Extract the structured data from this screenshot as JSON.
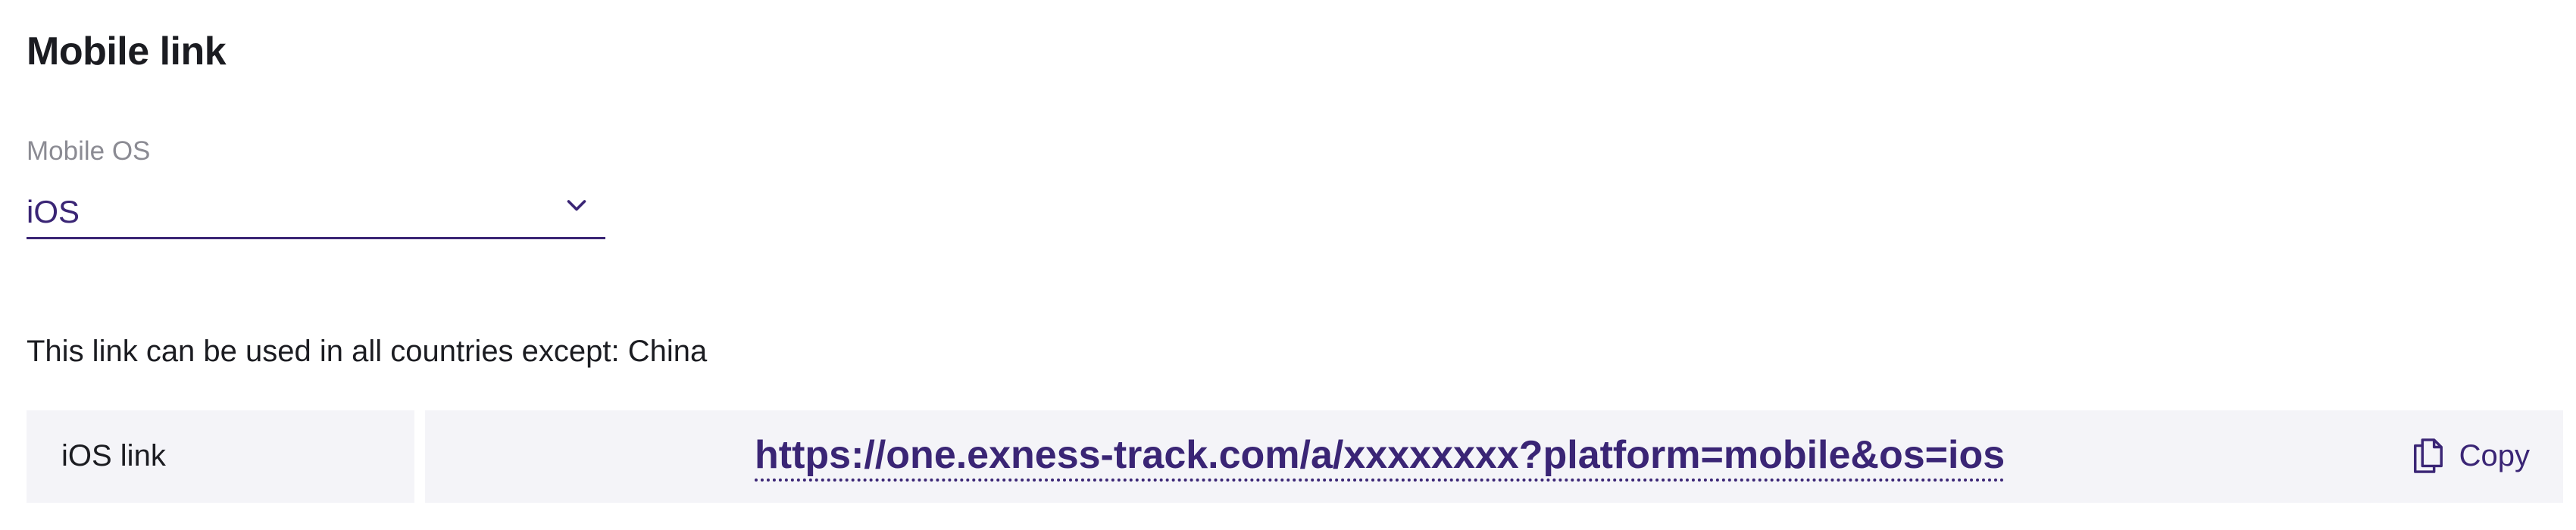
{
  "section": {
    "title": "Mobile link"
  },
  "mobile_os": {
    "label": "Mobile OS",
    "selected": "iOS",
    "icon": "chevron-down-icon"
  },
  "notice": {
    "text": "This link can be used in all countries except: China"
  },
  "link_row": {
    "label": "iOS link",
    "url": "https://one.exness-track.com/a/xxxxxxxx?platform=mobile&os=ios",
    "copy_label": "Copy",
    "copy_icon": "copy-icon"
  },
  "colors": {
    "accent": "#3a2575",
    "text": "#1b1c21",
    "muted": "#8b8b93",
    "cell_background": "#f4f4f8"
  }
}
